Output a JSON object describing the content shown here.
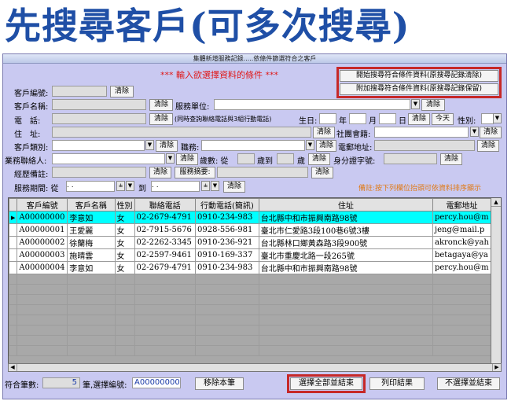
{
  "headline": "先搜尋客戶(可多次搜尋)",
  "window_title": "集體新增服務記錄.....依條件篩選符合之客戶",
  "criteria_title": "*** 輸入欲選擇資料的條件 ***",
  "actions": {
    "search_clear": "開始搜尋符合條件資料(原搜尋記錄清除)",
    "search_keep": "附加搜尋符合條件資料(原搜尋記錄保留)"
  },
  "form": {
    "client_no_label": "客戶編號:",
    "client_name_label": "客戶名稱:",
    "service_unit_label": "服務單位:",
    "phone_label": "電　話:",
    "phone_hint": "(同時查詢聯絡電話與3組行動電話)",
    "birthday_label": "生日:",
    "year_label": "年",
    "month_label": "月",
    "day_label": "日",
    "today_label": "今天",
    "gender_label": "性別:",
    "address_label": "住　址:",
    "community_label": "社團會籍:",
    "client_type_label": "客戶類別:",
    "position_label": "職務:",
    "email_label": "電郵地址:",
    "contact_label": "業務聯絡人:",
    "age_label": "歲數: 從",
    "age_to_label": "歲到",
    "age_unit_label": "歲",
    "id_label": "身分證字號:",
    "manager_note_label": "經歷備註:",
    "service_summary_label": "服務摘要:",
    "service_period_label": "服務期間: 從",
    "to_label": "到",
    "date_placeholder": " .   .",
    "clear_label": "清除",
    "hint": "備註:按下列欄位抬頭可依資料排序顯示"
  },
  "table": {
    "columns": [
      "客戶編號",
      "客戶名稱",
      "性別",
      "聯絡電話",
      "行動電話(簡訊)",
      "住址",
      "電郵地址"
    ],
    "rows": [
      [
        "A00000000",
        "李意如",
        "女",
        "02-2679-4791",
        "0910-234-983",
        "台北縣中和市振興南路98號",
        "percy.hou@m"
      ],
      [
        "A00000001",
        "王愛麗",
        "女",
        "02-7915-5676",
        "0928-556-981",
        "臺北市仁愛路3段100巷6號3樓",
        "jeng@mail.p"
      ],
      [
        "A00000002",
        "徐蘭梅",
        "女",
        "02-2262-3345",
        "0910-236-921",
        "台北縣林口鄉黃森路3段900號",
        "akronck@yah"
      ],
      [
        "A00000003",
        "施晴雲",
        "女",
        "02-2597-9461",
        "0910-169-337",
        "臺北市重慶北路一段265號",
        "betagaya@ya"
      ],
      [
        "A00000004",
        "李意如",
        "女",
        "02-2679-4791",
        "0910-234-983",
        "台北縣中和市振興南路98號",
        "percy.hou@m"
      ]
    ]
  },
  "footer": {
    "count_label": "符合筆數:",
    "count_value": "5",
    "selected_label": "筆,選擇編號:",
    "selected_value": "A00000000",
    "remove_label": "移除本筆",
    "select_all_label": "選擇全部並結束",
    "print_label": "列印結果",
    "cancel_label": "不選擇並結束"
  },
  "colors": {
    "headline": "#1f4fa6",
    "form_bg": "#c9c9f1",
    "criteria_red": "#e01818",
    "hint_orange": "#e07a16",
    "highlight_box": "#c62828",
    "selected_row": "#00ffff"
  }
}
